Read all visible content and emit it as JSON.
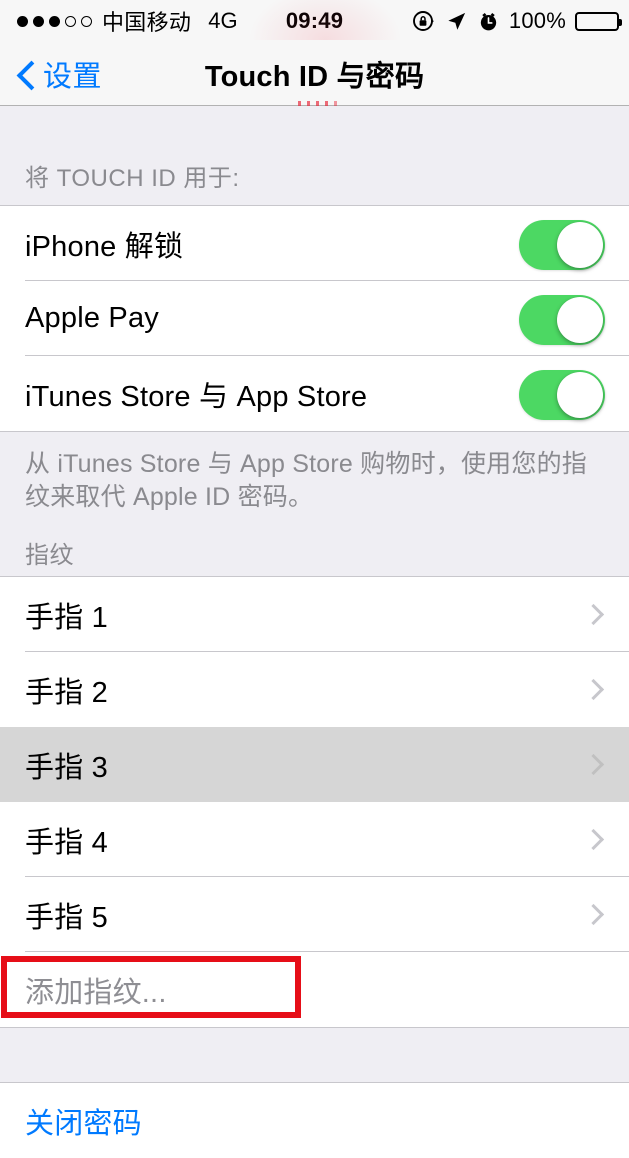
{
  "status_bar": {
    "signal_dots_filled": 3,
    "signal_dots_total": 5,
    "carrier": "中国移动",
    "network": "4G",
    "time": "09:49",
    "battery_percent": "100%",
    "icons": [
      "rotation-lock-icon",
      "location-arrow-icon",
      "alarm-clock-icon"
    ]
  },
  "nav_bar": {
    "back_label": "设置",
    "title": "Touch ID 与密码"
  },
  "sections": {
    "touch_id_use": {
      "header": "将 TOUCH ID 用于:",
      "rows": [
        {
          "label": "iPhone 解锁",
          "toggle": "on"
        },
        {
          "label": "Apple Pay",
          "toggle": "on"
        },
        {
          "label": "iTunes Store 与 App Store",
          "toggle": "on"
        }
      ],
      "footer": "从 iTunes Store 与 App Store 购物时，使用您的指纹来取代 Apple ID 密码。"
    },
    "fingerprints": {
      "header": "指纹",
      "rows": [
        {
          "label": "手指 1",
          "selected": false
        },
        {
          "label": "手指 2",
          "selected": false
        },
        {
          "label": "手指 3",
          "selected": true
        },
        {
          "label": "手指 4",
          "selected": false
        },
        {
          "label": "手指 5",
          "selected": false
        }
      ],
      "add_row": {
        "label": "添加指纹...",
        "disabled": true,
        "annotated": true
      }
    },
    "passcode": {
      "rows": [
        {
          "label": "关闭密码"
        }
      ]
    }
  },
  "colors": {
    "accent_blue": "#007AFF",
    "toggle_green": "#4CD863",
    "annotation_red": "#E60E18",
    "group_bg": "#EFEEF3",
    "selected_row": "#D6D6D6",
    "separator": "#C8C7CC",
    "muted_text": "#8A8A8F"
  }
}
